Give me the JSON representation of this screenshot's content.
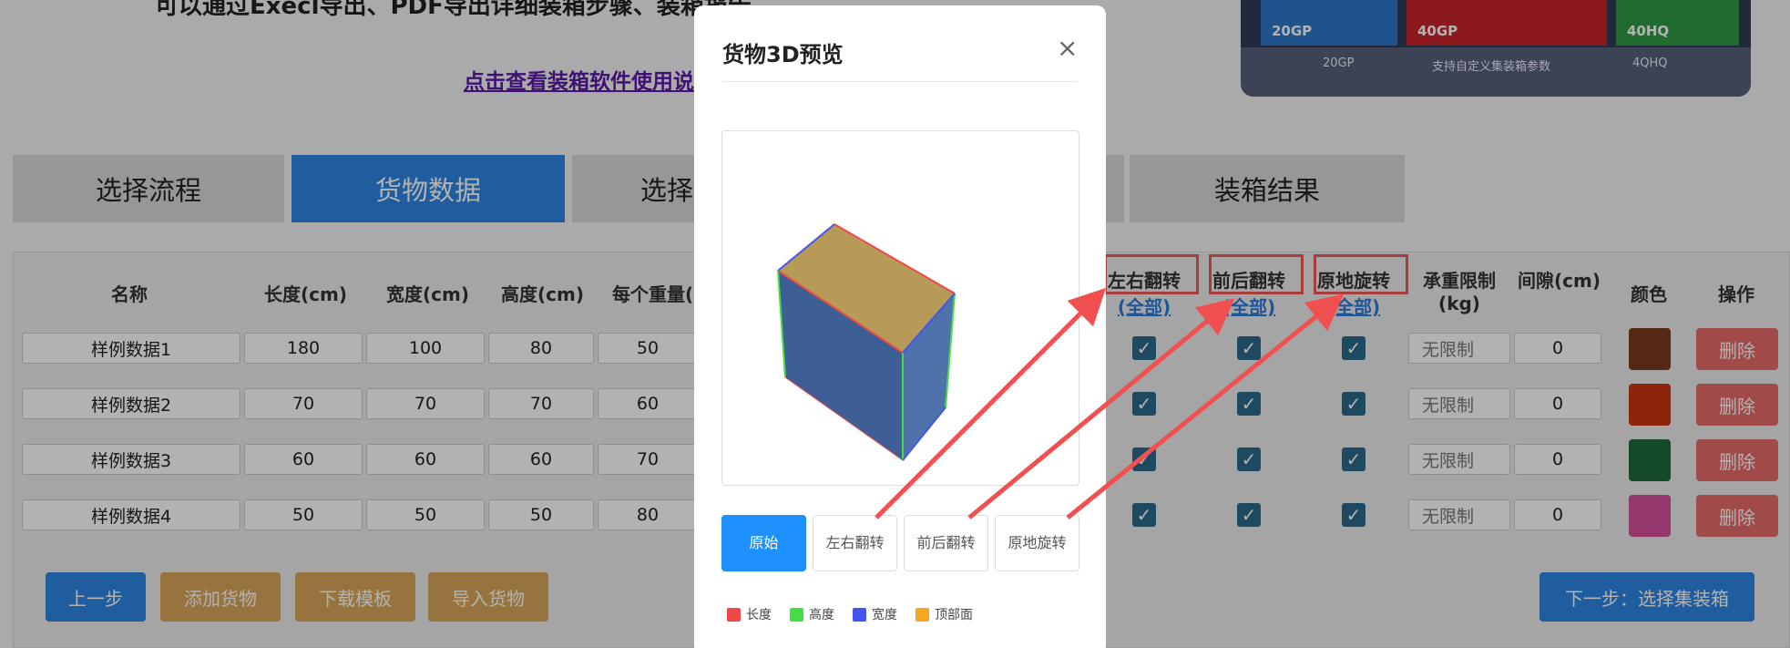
{
  "header": {
    "intro": "可以通过Execl导出、PDF导出详细装箱步骤、装箱报告",
    "help_link": "点击查看装箱软件使用说明"
  },
  "banner": {
    "containers": [
      "20GP",
      "40GP",
      "40HQ"
    ],
    "captions": [
      "20GP",
      "支持自定义集装箱参数",
      "4QHQ"
    ],
    "colors": [
      "#2b78c8",
      "#c8242a",
      "#2e9a46"
    ]
  },
  "tabs": [
    "选择流程",
    "货物数据",
    "选择",
    "装箱结果"
  ],
  "table": {
    "headers": {
      "name": "名称",
      "length": "长度(cm)",
      "width": "宽度(cm)",
      "height": "高度(cm)",
      "weight": "每个重量(",
      "flip_lr": "左右翻转",
      "flip_fb": "前后翻转",
      "rotate": "原地旋转",
      "all": "(全部)",
      "load_limit": "承重限制",
      "load_unit": "(kg)",
      "gap": "间隙(cm)",
      "color": "颜色",
      "action": "操作"
    },
    "rows": [
      {
        "name": "样例数据1",
        "length": "180",
        "width": "100",
        "height": "80",
        "weight": "50",
        "limit": "无限制",
        "gap": "0",
        "color": "#7a3a1e"
      },
      {
        "name": "样例数据2",
        "length": "70",
        "width": "70",
        "height": "70",
        "weight": "60",
        "limit": "无限制",
        "gap": "0",
        "color": "#c9330f"
      },
      {
        "name": "样例数据3",
        "length": "60",
        "width": "60",
        "height": "60",
        "weight": "70",
        "limit": "无限制",
        "gap": "0",
        "color": "#1f6b3a"
      },
      {
        "name": "样例数据4",
        "length": "50",
        "width": "50",
        "height": "50",
        "weight": "80",
        "limit": "无限制",
        "gap": "0",
        "color": "#d44f9a"
      }
    ],
    "delete_label": "删除",
    "check_mark": "✓"
  },
  "buttons": {
    "prev": "上一步",
    "add": "添加货物",
    "download": "下载模板",
    "import": "导入货物",
    "next": "下一步：选择集装箱"
  },
  "modal": {
    "title": "货物3D预览",
    "close": "×",
    "buttons": [
      "原始",
      "左右翻转",
      "前后翻转",
      "原地旋转"
    ],
    "legend": [
      {
        "label": "长度",
        "color": "#f04848"
      },
      {
        "label": "高度",
        "color": "#44dd44"
      },
      {
        "label": "宽度",
        "color": "#4455ee"
      },
      {
        "label": "顶部面",
        "color": "#f5a623"
      }
    ]
  }
}
